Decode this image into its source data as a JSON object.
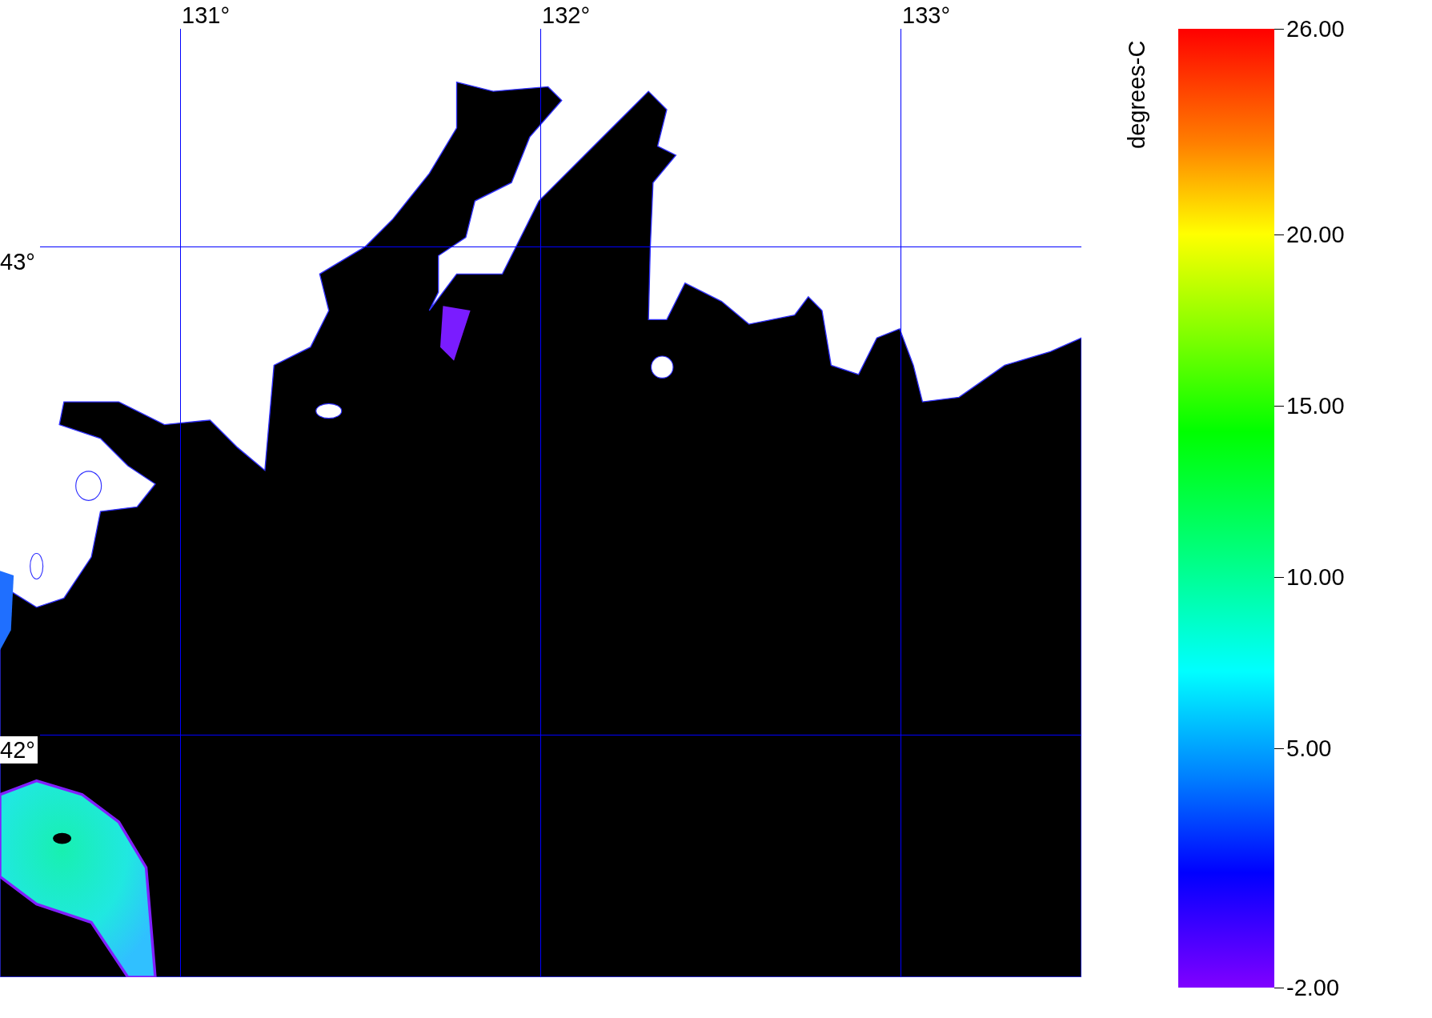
{
  "map": {
    "longitude_labels": [
      "131°",
      "132°",
      "133°"
    ],
    "latitude_labels": [
      "43°",
      "42°"
    ]
  },
  "colorbar": {
    "title": "degrees-C",
    "ticks": [
      "26.00",
      "20.00",
      "15.00",
      "10.00",
      "5.00",
      "-2.00"
    ]
  }
}
